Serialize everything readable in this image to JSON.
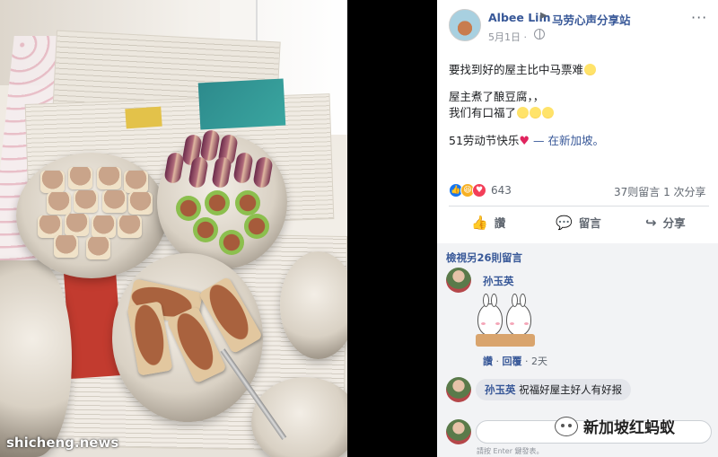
{
  "photo": {
    "watermark": "shicheng.news"
  },
  "post": {
    "author": "Albee Lim",
    "arrow": "▶",
    "group": "马劳心声分享站",
    "date": "5月1日 ·",
    "more": "···",
    "lines": [
      "要找到好的屋主比中马票难",
      "屋主煮了酿豆腐，，",
      "我们有口福了",
      "51劳动节快乐",
      "— 在新加坡。"
    ],
    "reaction_count": "643",
    "stats": "37则留言   1 次分享",
    "actions": {
      "like": "讚",
      "comment": "留言",
      "share": "分享"
    }
  },
  "comments": {
    "view_more": "檢視另26則留言",
    "c1": {
      "name": "孙玉英",
      "like": "讚",
      "reply": "回覆",
      "time": "2天"
    },
    "c2": {
      "name": "孙玉英",
      "text": "祝福好屋主好人有好报"
    },
    "hint": "請按 Enter 鍵發表。"
  },
  "brand": {
    "text": "新加坡红蚂蚁"
  },
  "colors": {
    "link": "#385898",
    "like": "#1877f2",
    "love": "#f33e58",
    "haha": "#f7b125"
  }
}
